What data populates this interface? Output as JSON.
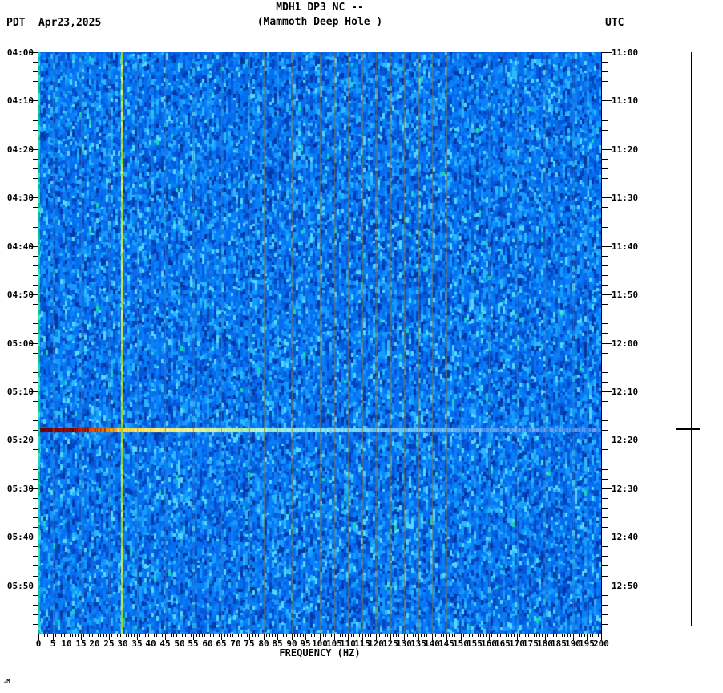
{
  "header": {
    "title": "MDH1 DP3 NC --",
    "subtitle": "(Mammoth Deep Hole )",
    "tz_left": "PDT",
    "date": "Apr23,2025",
    "tz_right": "UTC"
  },
  "footer": {
    "xlabel": "FREQUENCY (HZ)",
    "watermark": ".M"
  },
  "chart_data": {
    "type": "heatmap",
    "title": "MDH1 DP3 NC --",
    "subtitle": "(Mammoth Deep Hole )",
    "station": "MDH1 DP3 NC",
    "station_name": "Mammoth Deep Hole",
    "date": "Apr23,2025",
    "xlabel": "FREQUENCY (HZ)",
    "x_range_hz": [
      0,
      200
    ],
    "x_major_tick_step_hz": 5,
    "x_minor_tick_step_hz": 1,
    "x_tick_labels": [
      "0",
      "5",
      "10",
      "15",
      "20",
      "25",
      "30",
      "35",
      "40",
      "45",
      "50",
      "55",
      "60",
      "65",
      "70",
      "75",
      "80",
      "85",
      "90",
      "95",
      "100",
      "105",
      "110",
      "115",
      "120",
      "125",
      "130",
      "135",
      "140",
      "145",
      "150",
      "155",
      "160",
      "165",
      "170",
      "175",
      "180",
      "185",
      "190",
      "195",
      "200"
    ],
    "left_axis": {
      "timezone": "PDT",
      "start": "04:00",
      "end": "06:00",
      "major_step_min": 10,
      "minor_step_min": 2,
      "labels": [
        "04:00",
        "04:10",
        "04:20",
        "04:30",
        "04:40",
        "04:50",
        "05:00",
        "05:10",
        "05:20",
        "05:30",
        "05:40",
        "05:50"
      ]
    },
    "right_axis": {
      "timezone": "UTC",
      "start": "11:00",
      "end": "13:00",
      "major_step_min": 10,
      "minor_step_min": 2,
      "labels": [
        "11:00",
        "11:10",
        "11:20",
        "11:30",
        "11:40",
        "11:50",
        "12:00",
        "12:10",
        "12:20",
        "12:30",
        "12:40",
        "12:50"
      ]
    },
    "colors": {
      "background_noise": "#0566e8",
      "noise_palette": [
        "#0336a0",
        "#0443bc",
        "#0557d8",
        "#056ef0",
        "#0880fa",
        "#149cff",
        "#2cb8ff",
        "#55d8ff"
      ],
      "gridline": "#807646",
      "dc_column": "#00c896",
      "spectral_line_29hz": "#c8f046",
      "spectral_line_60hz": "#a0e678",
      "event_gradient": [
        "#640000",
        "#aa0000",
        "#f04800",
        "#ffa800",
        "#ffd020",
        "#f2ee7a",
        "#b8f2a8",
        "#84e6e6",
        "#62c4fa",
        "#3684ee"
      ]
    },
    "features": {
      "event_band": {
        "time_pdt": "05:18",
        "time_utc": "12:18",
        "description": "Broadband transient (earthquake): dark red at 0-8 Hz grading through red, orange, yellow, pale green to light cyan-blue at high frequencies, spanning full 0-200 Hz width"
      },
      "persistent_spectral_lines_hz": [
        29,
        60
      ],
      "dc_column_hz": 0,
      "gridlines_every_hz": 5
    },
    "scale_bar": {
      "event_marker_time_utc": "12:18"
    }
  }
}
